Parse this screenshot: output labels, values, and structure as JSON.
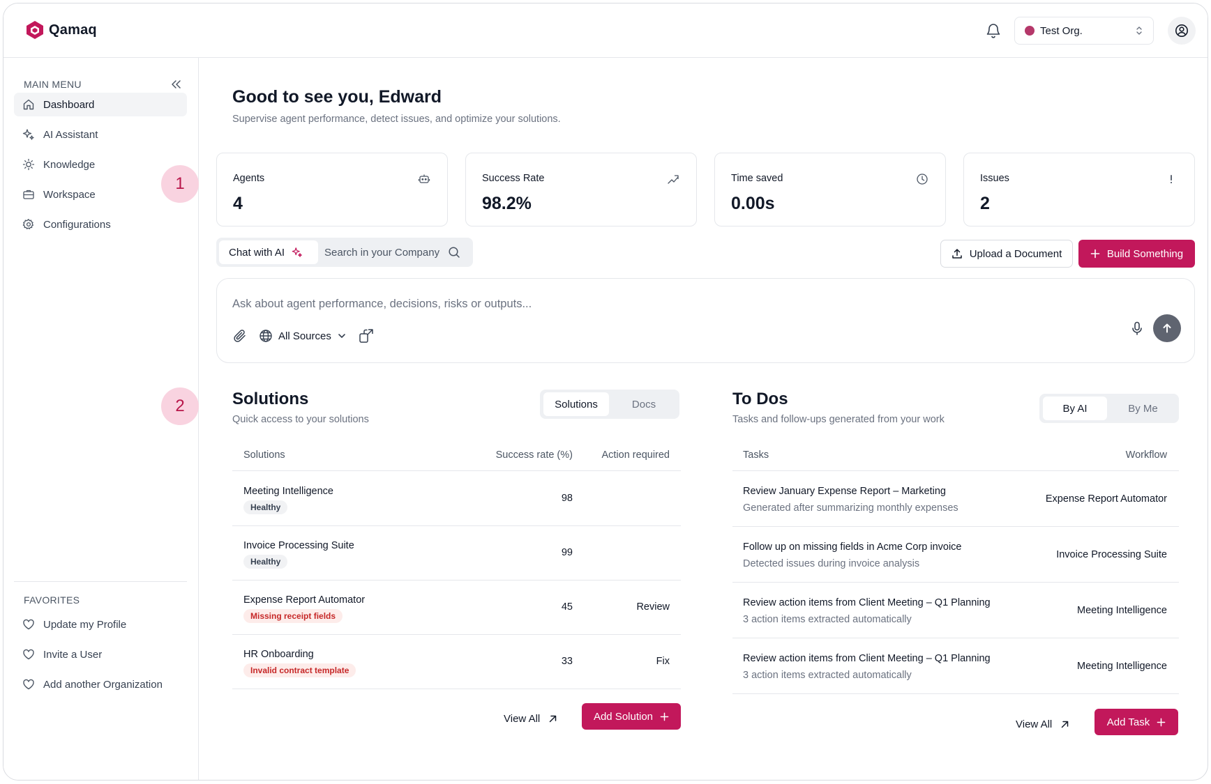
{
  "app": {
    "brand": "Qamaq",
    "brand_color": "#c2185b"
  },
  "header": {
    "org_name": "Test Org.",
    "org_color": "#b5386a"
  },
  "sidebar": {
    "menu_heading": "MAIN MENU",
    "items": [
      {
        "label": "Dashboard",
        "icon": "home-icon",
        "active": true
      },
      {
        "label": "AI Assistant",
        "icon": "sparkle-icon"
      },
      {
        "label": "Knowledge",
        "icon": "lightbulb-icon"
      },
      {
        "label": "Workspace",
        "icon": "briefcase-icon"
      },
      {
        "label": "Configurations",
        "icon": "gear-icon"
      }
    ],
    "favorites_heading": "FAVORITES",
    "favorites": [
      {
        "label": "Update my Profile",
        "icon": "heart-icon"
      },
      {
        "label": "Invite a User",
        "icon": "heart-icon"
      },
      {
        "label": "Add another Organization",
        "icon": "heart-icon"
      }
    ]
  },
  "markers": [
    "1",
    "2"
  ],
  "main": {
    "greeting": "Good to see you, Edward",
    "subtitle": "Supervise agent performance, detect issues, and optimize your solutions.",
    "stats": [
      {
        "label": "Agents",
        "value": "4",
        "icon": "robot-icon"
      },
      {
        "label": "Success Rate",
        "value": "98.2%",
        "icon": "trend-arrow-icon"
      },
      {
        "label": "Time saved",
        "value": "0.00s",
        "icon": "clock-icon"
      },
      {
        "label": "Issues",
        "value": "2",
        "icon": "exclamation-icon"
      }
    ],
    "chat_tab": "Chat with AI",
    "search_tab": "Search in your Company",
    "upload_button": "Upload a Document",
    "build_button": "Build Something",
    "chat_placeholder": "Ask about agent performance, decisions, risks or outputs...",
    "sources_label": "All Sources"
  },
  "solutions": {
    "title": "Solutions",
    "subtitle": "Quick access to your solutions",
    "tabs": [
      "Solutions",
      "Docs"
    ],
    "columns": [
      "Solutions",
      "Success rate (%)",
      "Action required"
    ],
    "rows": [
      {
        "name": "Meeting Intelligence",
        "badge": "Healthy",
        "rate": "98",
        "action": ""
      },
      {
        "name": "Invoice Processing Suite",
        "badge": "Healthy",
        "rate": "99",
        "action": ""
      },
      {
        "name": "Expense Report Automator",
        "badge": "Missing receipt fields",
        "rate": "45",
        "action": "Review"
      },
      {
        "name": "HR Onboarding",
        "badge": "Invalid contract template",
        "rate": "33",
        "action": "Fix"
      }
    ],
    "view_all": "View All",
    "add_button": "Add Solution"
  },
  "todos": {
    "title": "To Dos",
    "subtitle": "Tasks and follow-ups generated from your work",
    "tabs": [
      "By AI",
      "By Me"
    ],
    "columns": [
      "Tasks",
      "Workflow"
    ],
    "rows": [
      {
        "task": "Review January Expense Report – Marketing",
        "detail": "Generated after summarizing monthly expenses",
        "workflow": "Expense Report Automator"
      },
      {
        "task": "Follow up on missing fields in Acme Corp invoice",
        "detail": "Detected issues during invoice analysis",
        "workflow": "Invoice Processing Suite"
      },
      {
        "task": "Review action items from Client Meeting – Q1 Planning",
        "detail": "3 action items extracted automatically",
        "workflow": "Meeting Intelligence"
      },
      {
        "task": "Review action items from Client Meeting – Q1 Planning",
        "detail": "3 action items extracted automatically",
        "workflow": "Meeting Intelligence"
      }
    ],
    "view_all": "View All",
    "add_button": "Add Task"
  }
}
